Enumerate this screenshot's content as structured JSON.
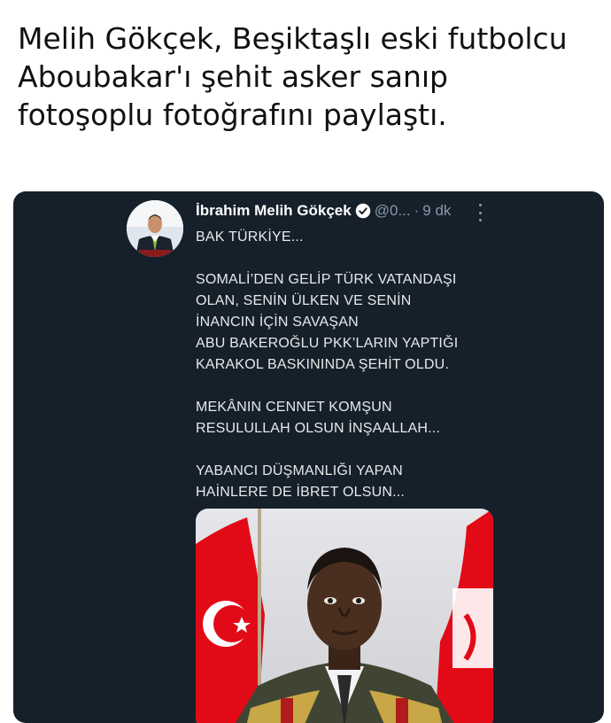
{
  "headline": {
    "lines": [
      "Melih Gökçek, Beşiktaşlı eski futbolcu",
      "Aboubakar'ı şehit asker sanıp",
      "fotoşoplu fotoğrafını paylaştı."
    ]
  },
  "tweet": {
    "author_name": "İbrahim Melih Gökçek",
    "handle": "@0...",
    "separator": "·",
    "time": "9 dk",
    "avatar_icon": "profile-photo",
    "verified_icon": "verified-badge-icon",
    "more_icon": "more-vertical-icon",
    "paragraphs": [
      [
        "BAK TÜRKİYE..."
      ],
      [
        "SOMALİ’DEN GELİP TÜRK VATANDAŞI",
        "OLAN, SENİN ÜLKEN VE SENİN",
        "İNANCIN İÇİN SAVAŞAN",
        "ABU BAKEROĞLU PKK’LARIN YAPTIĞI",
        "KARAKOL BASKININDA ŞEHİT OLDU."
      ],
      [
        "MEKÂNIN CENNET KOMŞUN",
        "RESULULLAH OLSUN İNŞAALLAH..."
      ],
      [
        "YABANCI DÜŞMANLIĞI YAPAN",
        "HAİNLERE DE İBRET OLSUN..."
      ]
    ]
  },
  "colors": {
    "card_bg": "#15202b",
    "text_primary": "#e7e9ea",
    "text_secondary": "#8b98a5",
    "verified_blue": "#1d9bf0",
    "flag_red": "#e30a17"
  }
}
